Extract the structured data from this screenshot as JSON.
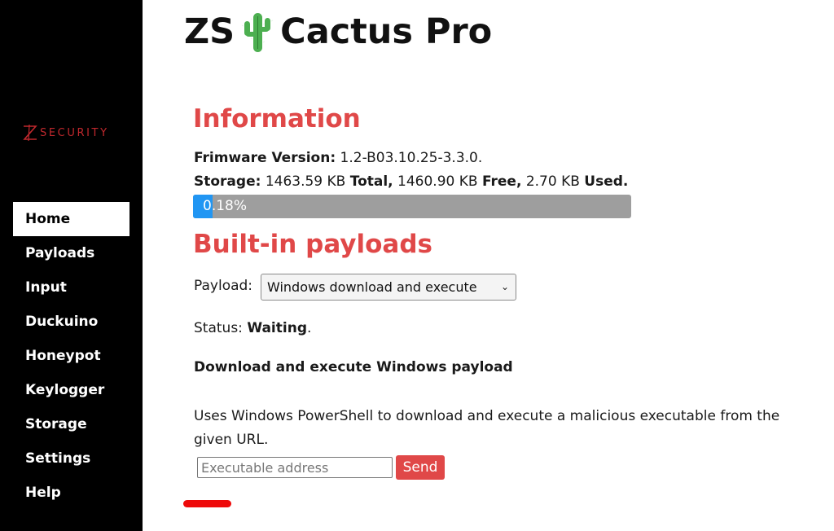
{
  "brand": {
    "logo_text": "SECURITY",
    "logo_color": "#c0282d"
  },
  "sidebar": {
    "items": [
      {
        "label": "Home",
        "active": true
      },
      {
        "label": "Payloads"
      },
      {
        "label": "Input"
      },
      {
        "label": "Duckuino"
      },
      {
        "label": "Honeypot"
      },
      {
        "label": "Keylogger"
      },
      {
        "label": "Storage"
      },
      {
        "label": "Settings"
      },
      {
        "label": "Help"
      }
    ]
  },
  "header": {
    "title_left": "ZS",
    "title_right": "Cactus Pro",
    "icon": "cactus-icon"
  },
  "information": {
    "heading": "Information",
    "firmware_label": "Frimware Version:",
    "firmware_value": "1.2-B03.10.25-3.3.0.",
    "storage_label": "Storage:",
    "storage_total_value": "1463.59 KB",
    "total_label": "Total,",
    "storage_free_value": "1460.90 KB",
    "free_label": "Free,",
    "storage_used_value": "2.70 KB",
    "used_label": "Used.",
    "usage_percent_text": "0.18%",
    "usage_fraction": 0.0018
  },
  "payloads": {
    "heading": "Built-in payloads",
    "payload_label": "Payload:",
    "selected_payload": "Windows download and execute",
    "status_label": "Status:",
    "status_value": "Waiting",
    "status_end": ".",
    "payload_title": "Download and execute Windows payload",
    "payload_description": "Uses Windows PowerShell to download and execute a malicious executable from the given URL.",
    "address_placeholder": "Executable address",
    "address_value": "",
    "send_label": "Send"
  },
  "colors": {
    "accent_red": "#e04848",
    "progress_blue": "#2196f3",
    "progress_bg": "#9e9e9e",
    "sidebar_bg": "#000000"
  }
}
